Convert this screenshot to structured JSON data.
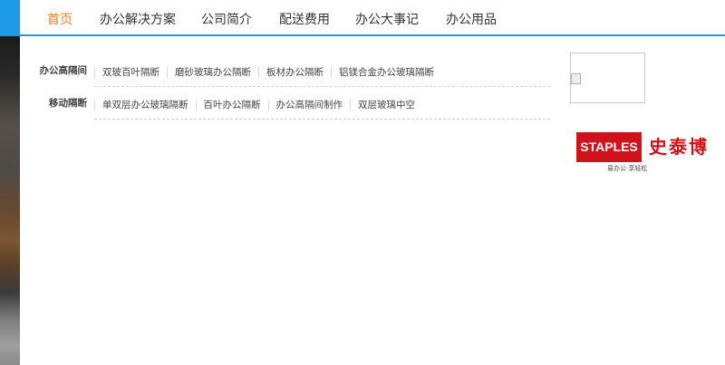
{
  "nav": {
    "items": [
      {
        "label": "首页",
        "active": true
      },
      {
        "label": "办公解决方案",
        "active": false
      },
      {
        "label": "公司简介",
        "active": false
      },
      {
        "label": "配送费用",
        "active": false
      },
      {
        "label": "办公大事记",
        "active": false
      },
      {
        "label": "办公用品",
        "active": false
      }
    ],
    "accent_color": "#1e9be6",
    "active_color": "#ff7a1a"
  },
  "menu": {
    "rows": [
      {
        "category": "办公高隔间",
        "links": [
          "双玻百叶隔断",
          "磨砂玻璃办公隔断",
          "板材办公隔断",
          "铝镁合金办公玻璃隔断"
        ]
      },
      {
        "category": "移动隔断",
        "links": [
          "单双层办公玻璃隔断",
          "百叶办公隔断",
          "办公高隔间制作",
          "双层玻璃中空"
        ]
      }
    ]
  },
  "aside": {
    "broken_image_icon": "broken-image-icon",
    "logo": {
      "wordmark": "STAPLES",
      "chinese_name": "史泰博",
      "slogan": "易办公·享轻松",
      "brand_color": "#d0121b"
    }
  }
}
